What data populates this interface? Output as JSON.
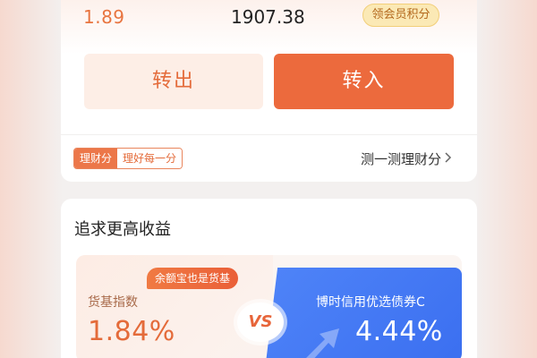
{
  "summary": {
    "yesterday_earnings": "1.89",
    "total_amount": "1907.38",
    "points_badge": "领会员积分"
  },
  "actions": {
    "transfer_out_label": "转出",
    "transfer_in_label": "转入"
  },
  "finance_score": {
    "tag_main": "理财分",
    "tag_sub": "理好每一分",
    "link_label": "测一测理财分"
  },
  "higher_yield": {
    "title": "追求更高收益",
    "tooltip": "余额宝也是货基",
    "left": {
      "label": "货基指数",
      "rate": "1.84%"
    },
    "vs": "VS",
    "right": {
      "label": "博时信用优选债券C",
      "rate": "4.44%"
    }
  },
  "colors": {
    "accent": "#ec6a3d",
    "blue": "#3b6ff0"
  }
}
